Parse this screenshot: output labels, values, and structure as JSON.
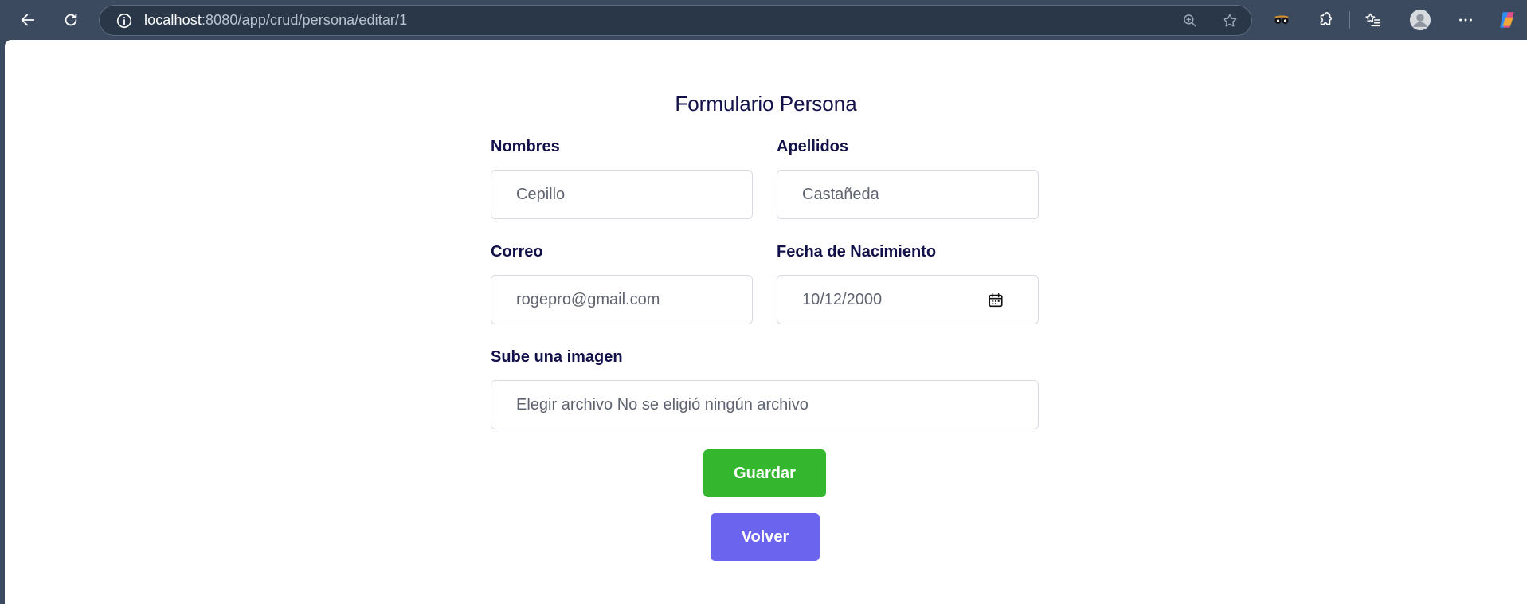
{
  "browser": {
    "url_host": "localhost",
    "url_path": ":8080/app/crud/persona/editar/1"
  },
  "form": {
    "title": "Formulario Persona",
    "fields": {
      "nombres": {
        "label": "Nombres",
        "value": "Cepillo"
      },
      "apellidos": {
        "label": "Apellidos",
        "value": "Castañeda"
      },
      "correo": {
        "label": "Correo",
        "value": "rogepro@gmail.com"
      },
      "fecha": {
        "label": "Fecha de Nacimiento",
        "value": "10/12/2000"
      },
      "imagen": {
        "label": "Sube una imagen",
        "value": "Elegir archivo No se eligió ningún archivo"
      }
    },
    "buttons": {
      "guardar": "Guardar",
      "volver": "Volver"
    }
  },
  "colors": {
    "guardar": "#34b72e",
    "volver": "#6a64ef",
    "text": "#13114a"
  }
}
